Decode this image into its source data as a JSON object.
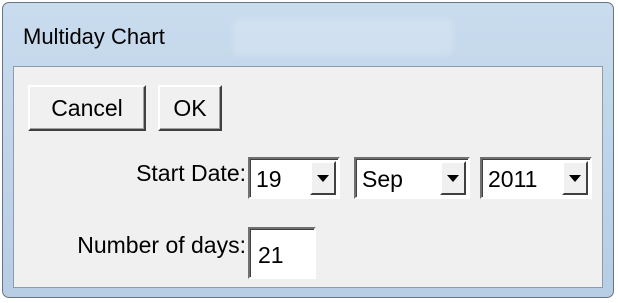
{
  "window": {
    "title": "Multiday Chart"
  },
  "buttons": {
    "cancel_label": "Cancel",
    "ok_label": "OK"
  },
  "form": {
    "start_date_label": "Start Date:",
    "start_day": "19",
    "start_month": "Sep",
    "start_year": "2011",
    "days_label": "Number of days:",
    "days_value": "21"
  },
  "icons": {
    "dropdown": "chevron-down-icon"
  },
  "colors": {
    "frame": "#b7cde4",
    "client": "#f0f0f0"
  }
}
